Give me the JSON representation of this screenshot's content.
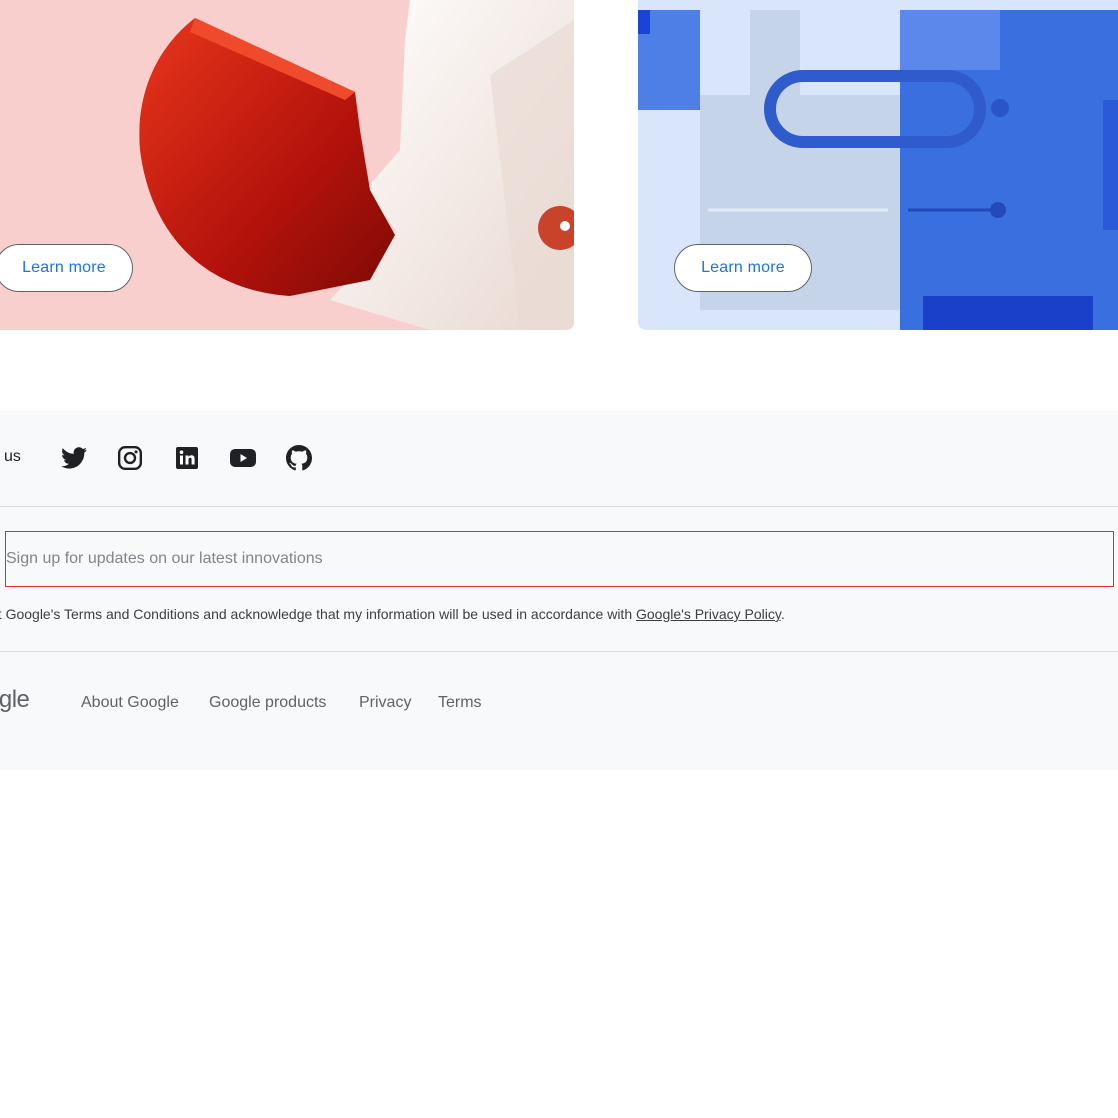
{
  "cards": [
    {
      "learn_more": "Learn more"
    },
    {
      "learn_more": "Learn more"
    }
  ],
  "footer": {
    "follow_label": "w us",
    "social": [
      {
        "icon": "twitter-icon"
      },
      {
        "icon": "instagram-icon"
      },
      {
        "icon": "linkedin-icon"
      },
      {
        "icon": "youtube-icon"
      },
      {
        "icon": "github-icon"
      }
    ],
    "signup_placeholder": "Sign up for updates on our latest innovations",
    "consent_prefix": "pt Google's Terms and Conditions and acknowledge that my information will be used in accordance with ",
    "privacy_link": "Google's Privacy Policy",
    "consent_suffix": ".",
    "logo_text": "ogle",
    "links": [
      "About Google",
      "Google products",
      "Privacy",
      "Terms"
    ]
  },
  "colors": {
    "accent": "#1a73e8",
    "card_left_bg": "#f9cfcd",
    "card_right_bg": "#d8e5fb",
    "footer_bg": "#f8f9fa",
    "input_border": "#d93025"
  }
}
